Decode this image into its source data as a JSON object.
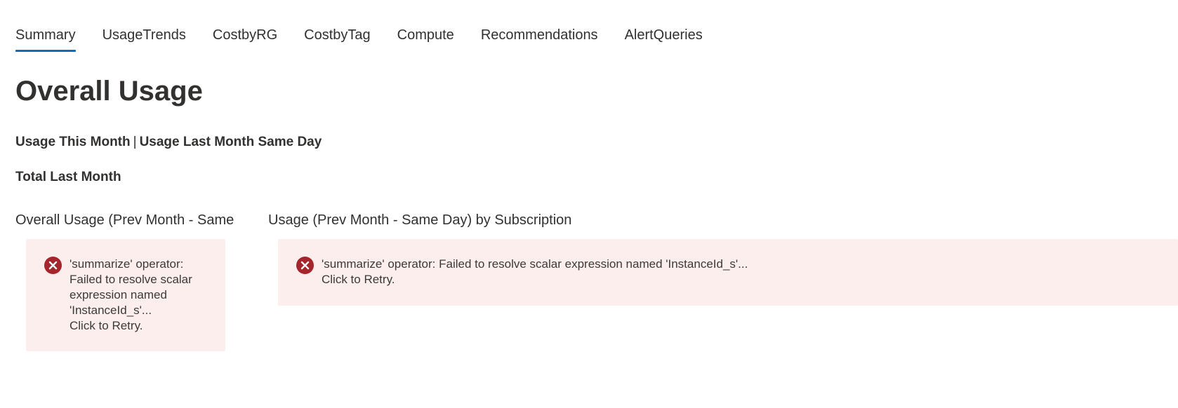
{
  "tabs": [
    {
      "label": "Summary",
      "active": true
    },
    {
      "label": "UsageTrends",
      "active": false
    },
    {
      "label": "CostbyRG",
      "active": false
    },
    {
      "label": "CostbyTag",
      "active": false
    },
    {
      "label": "Compute",
      "active": false
    },
    {
      "label": "Recommendations",
      "active": false
    },
    {
      "label": "AlertQueries",
      "active": false
    }
  ],
  "header": {
    "title": "Overall Usage",
    "usage_this_month": "Usage This Month",
    "separator": "|",
    "usage_last_month_same_day": "Usage Last Month Same Day",
    "total_last_month": "Total Last Month"
  },
  "panels": [
    {
      "title": "Overall Usage (Prev Month - Same",
      "error_message": "'summarize' operator: Failed to resolve scalar expression named 'InstanceId_s'...",
      "retry_label": "Click to Retry."
    },
    {
      "title": "Usage (Prev Month - Same Day) by Subscription",
      "error_message": "'summarize' operator: Failed to resolve scalar expression named 'InstanceId_s'...",
      "retry_label": "Click to Retry."
    }
  ],
  "colors": {
    "accent": "#0f6cbd",
    "error_icon": "#a4262c",
    "error_background": "#fdeeee"
  },
  "icons": {
    "error": "error-circle-x-icon"
  }
}
